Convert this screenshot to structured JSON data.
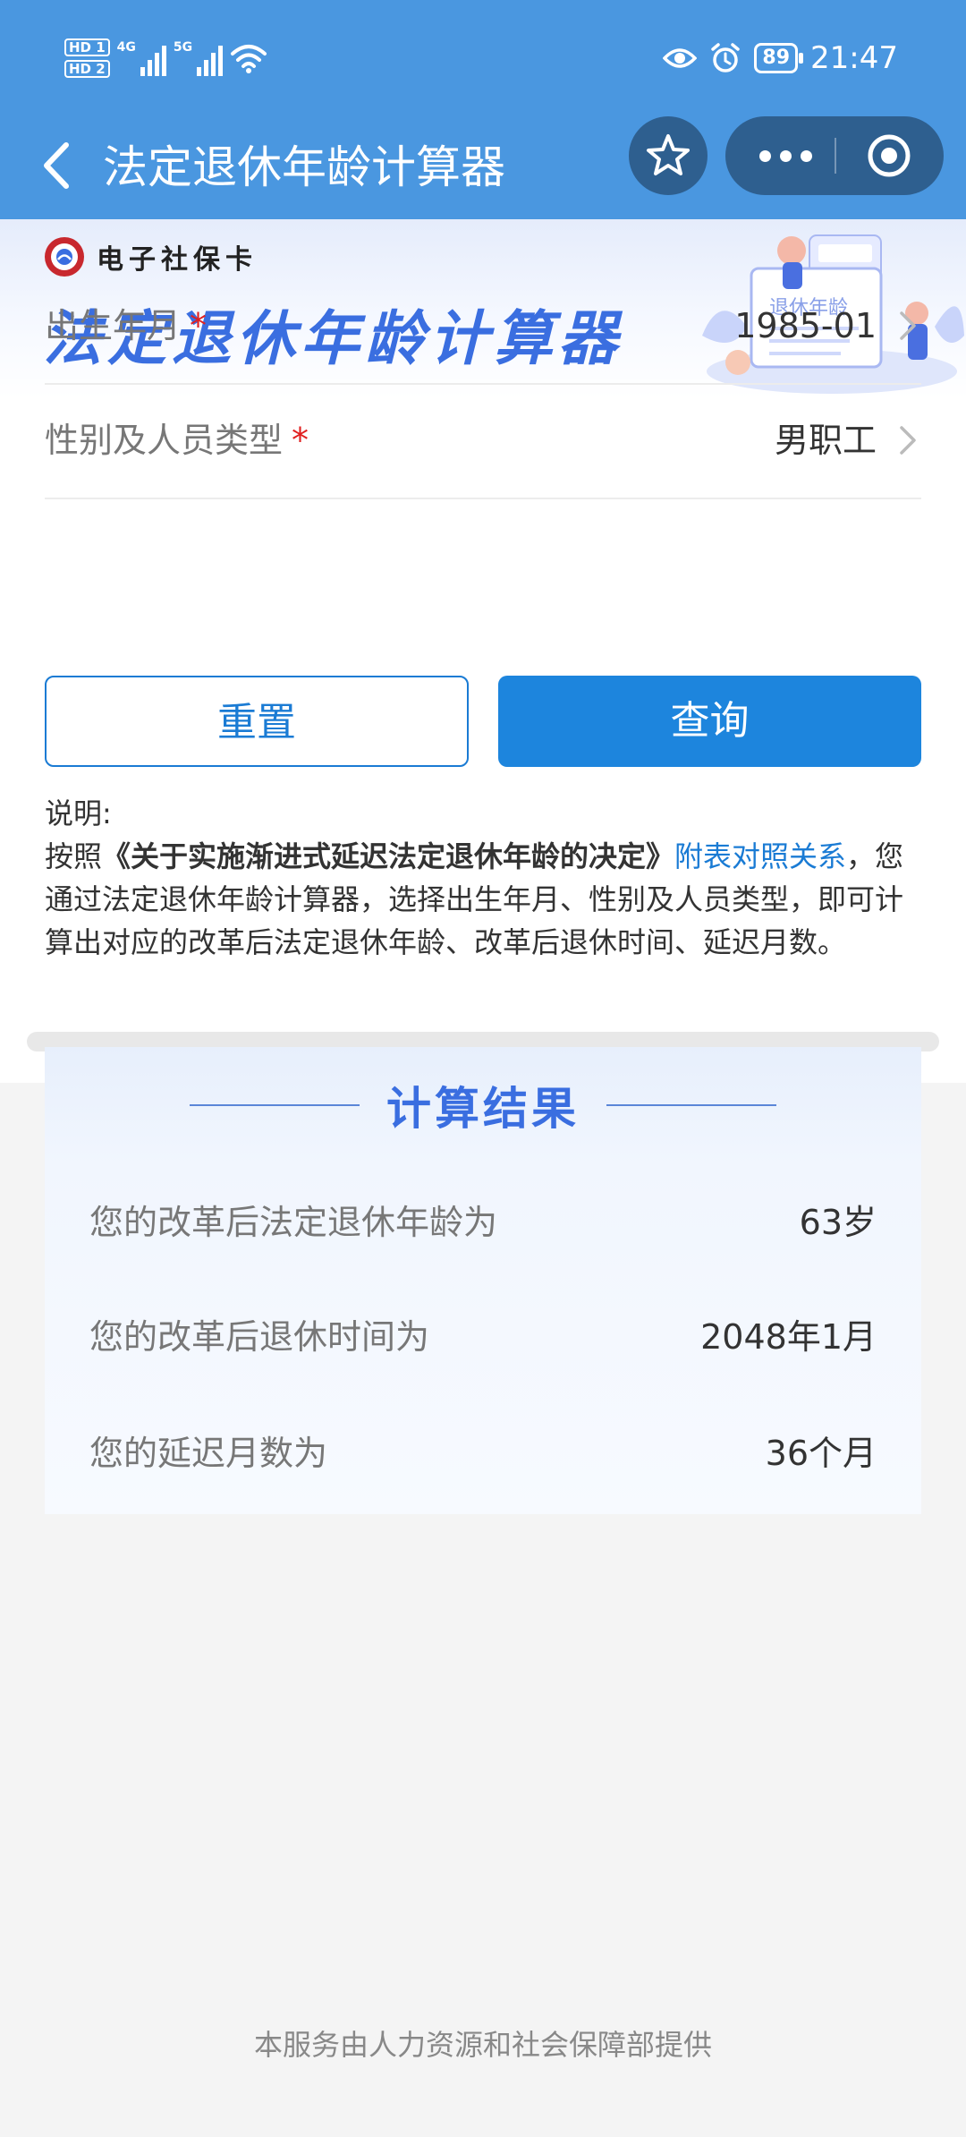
{
  "status_bar": {
    "sim1": "HD 1",
    "sim2": "HD 2",
    "net1": "4G",
    "net2": "5G",
    "battery": "89",
    "time": "21:47"
  },
  "nav": {
    "title": "法定退休年龄计算器"
  },
  "banner": {
    "brand": "电子社保卡",
    "title": "法定退休年龄计算器",
    "illustration_text": "退休年龄"
  },
  "form": {
    "birth": {
      "label": "出生年月",
      "required": "*",
      "value": "1985-01"
    },
    "gender": {
      "label": "性别及人员类型",
      "required": "*",
      "value": "男职工"
    }
  },
  "buttons": {
    "reset": "重置",
    "query": "查询"
  },
  "notes": {
    "heading": "说明:",
    "prefix": "按照",
    "document": "《关于实施渐进式延迟法定退休年龄的决定》",
    "link": "附表对照关系",
    "suffix": "，您通过法定退休年龄计算器，选择出生年月、性别及人员类型，即可计算出对应的改革后法定退休年龄、改革后退休时间、延迟月数。"
  },
  "result": {
    "title": "计算结果",
    "rows": [
      {
        "label": "您的改革后法定退休年龄为",
        "value": "63岁"
      },
      {
        "label": "您的改革后退休时间为",
        "value": "2048年1月"
      },
      {
        "label": "您的延迟月数为",
        "value": "36个月"
      }
    ]
  },
  "footer": {
    "text": "本服务由人力资源和社会保障部提供"
  },
  "colors": {
    "header_bg": "#4a97e0",
    "primary": "#1d85dd",
    "accent_title": "#3a6ee0",
    "required": "#e02020"
  }
}
